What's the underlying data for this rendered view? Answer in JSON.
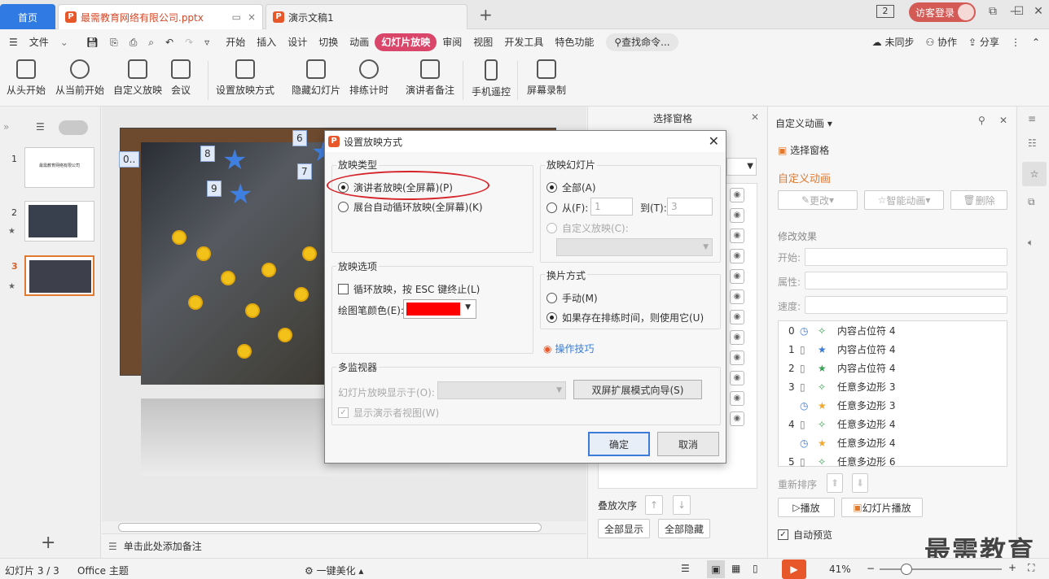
{
  "titlebar": {
    "tabs": [
      {
        "label": "首页"
      },
      {
        "label": "最需教育网络有限公司.pptx"
      },
      {
        "label": "演示文稿1"
      }
    ],
    "badge": "2",
    "guest": "访客登录"
  },
  "menu": {
    "file": "文件",
    "items": [
      "开始",
      "插入",
      "设计",
      "切换",
      "动画",
      "幻灯片放映",
      "审阅",
      "视图",
      "开发工具",
      "特色功能"
    ],
    "active": "幻灯片放映",
    "search": "查找命令...",
    "sync": "未同步",
    "collab": "协作",
    "share": "分享"
  },
  "ribbon": {
    "items": [
      "从头开始",
      "从当前开始",
      "自定义放映",
      "会议",
      "设置放映方式",
      "隐藏幻灯片",
      "排练计时",
      "演讲者备注",
      "手机遥控",
      "屏幕录制"
    ]
  },
  "slides": {
    "numbers": [
      "1",
      "2",
      "3"
    ],
    "thumb1_text": "最需教育网络有限公司"
  },
  "canvas": {
    "tags": [
      "0..",
      "8",
      "9",
      "6",
      "7"
    ],
    "notes": "单击此处添加备注"
  },
  "selection_pane": {
    "title": "选择窗格",
    "order_label": "叠放次序",
    "show_all": "全部显示",
    "hide_all": "全部隐藏"
  },
  "anim_pane": {
    "header": "自定义动画",
    "select_pane": "选择窗格",
    "section": "自定义动画",
    "change": "更改",
    "smart": "智能动画",
    "delete": "删除",
    "modify": "修改效果",
    "start": "开始:",
    "property": "属性:",
    "speed": "速度:",
    "list": [
      {
        "num": "0",
        "name": "内容占位符 4"
      },
      {
        "num": "1",
        "name": "内容占位符 4"
      },
      {
        "num": "2",
        "name": "内容占位符 4"
      },
      {
        "num": "3",
        "name": "任意多边形 3"
      },
      {
        "num": "",
        "name": "任意多边形 3"
      },
      {
        "num": "4",
        "name": "任意多边形 4"
      },
      {
        "num": "",
        "name": "任意多边形 4"
      },
      {
        "num": "5",
        "name": "任意多边形 6"
      }
    ],
    "reorder": "重新排序",
    "play": "播放",
    "slideshow": "幻灯片播放",
    "autopreview": "自动预览"
  },
  "status": {
    "slide": "幻灯片 3 / 3",
    "theme": "Office 主题",
    "beautify": "一键美化",
    "zoom": "41%"
  },
  "watermark": "最需教育",
  "dialog": {
    "title": "设置放映方式",
    "type_group": "放映类型",
    "type_opt1": "演讲者放映(全屏幕)(P)",
    "type_opt2": "展台自动循环放映(全屏幕)(K)",
    "slides_group": "放映幻灯片",
    "all": "全部(A)",
    "from": "从(F):",
    "from_val": "1",
    "to": "到(T):",
    "to_val": "3",
    "custom": "自定义放映(C):",
    "options_group": "放映选项",
    "loop": "循环放映，按 ESC 键终止(L)",
    "pen_color": "绘图笔颜色(E):",
    "pen_color_value": "#ff0000",
    "advance_group": "换片方式",
    "manual": "手动(M)",
    "timing": "如果存在排练时间，则使用它(U)",
    "tips": "操作技巧",
    "monitor_group": "多监视器",
    "show_on": "幻灯片放映显示于(O):",
    "wizard": "双屏扩展模式向导(S)",
    "presenter_view": "显示演示者视图(W)",
    "ok": "确定",
    "cancel": "取消"
  }
}
